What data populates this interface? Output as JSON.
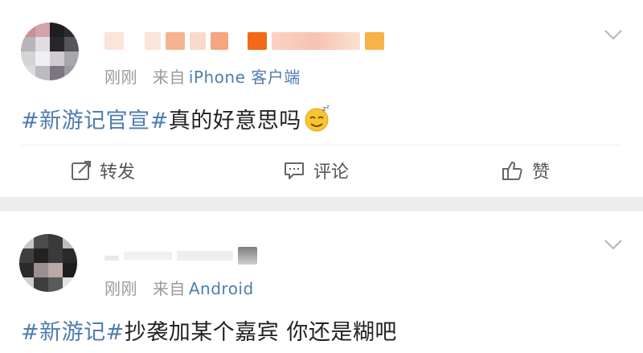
{
  "posts": [
    {
      "time": "刚刚",
      "source_prefix": "来自",
      "source": "iPhone 客户端",
      "hashtag": "#新游记官宣#",
      "text": "真的好意思吗",
      "emoji": "sleepy-smile-emoji",
      "actions": {
        "repost_label": "转发",
        "comment_label": "评论",
        "like_label": "赞"
      }
    },
    {
      "time": "刚刚",
      "source_prefix": "来自",
      "source": "Android",
      "hashtag": "#新游记#",
      "text": "抄袭加某个嘉宾 你还是糊吧"
    }
  ],
  "icons": {
    "more": "chevron-down-icon",
    "repost": "repost-icon",
    "comment": "comment-icon",
    "like": "thumbs-up-icon"
  },
  "colors": {
    "link": "#4f7cb0",
    "meta": "#9a9a9a",
    "band": "#ededed"
  }
}
